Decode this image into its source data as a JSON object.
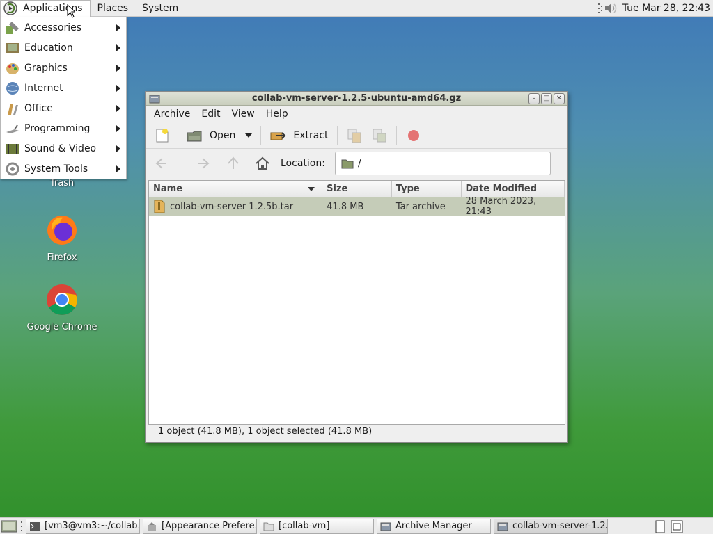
{
  "top_panel": {
    "menus": [
      "Applications",
      "Places",
      "System"
    ],
    "clock": "Tue Mar 28, 22:43"
  },
  "app_menu": {
    "items": [
      {
        "label": "Accessories",
        "icon": "accessories-icon"
      },
      {
        "label": "Education",
        "icon": "education-icon"
      },
      {
        "label": "Graphics",
        "icon": "graphics-icon"
      },
      {
        "label": "Internet",
        "icon": "internet-icon"
      },
      {
        "label": "Office",
        "icon": "office-icon"
      },
      {
        "label": "Programming",
        "icon": "programming-icon"
      },
      {
        "label": "Sound & Video",
        "icon": "sound-video-icon"
      },
      {
        "label": "System Tools",
        "icon": "system-tools-icon"
      }
    ]
  },
  "desktop": {
    "icons": [
      {
        "label": "Trash",
        "icon": "trash-icon"
      },
      {
        "label": "Firefox",
        "icon": "firefox-icon"
      },
      {
        "label": "Google Chrome",
        "icon": "chrome-icon"
      }
    ]
  },
  "window": {
    "title": "collab-vm-server-1.2.5-ubuntu-amd64.gz",
    "menubar": [
      "Archive",
      "Edit",
      "View",
      "Help"
    ],
    "toolbar": {
      "open_label": "Open",
      "extract_label": "Extract"
    },
    "location": {
      "label": "Location:",
      "value": "/"
    },
    "columns": [
      "Name",
      "Size",
      "Type",
      "Date Modified"
    ],
    "rows": [
      {
        "name": "collab-vm-server 1.2.5b.tar",
        "size": "41.8 MB",
        "type": "Tar archive",
        "modified": "28 March 2023, 21:43"
      }
    ],
    "status": "1 object (41.8 MB), 1 object selected (41.8 MB)"
  },
  "taskbar": {
    "tasks": [
      {
        "label": "[vm3@vm3:~/collab...",
        "icon": "terminal-icon"
      },
      {
        "label": "[Appearance Prefere...",
        "icon": "appearance-icon"
      },
      {
        "label": "[collab-vm]",
        "icon": "folder-icon"
      },
      {
        "label": "Archive Manager",
        "icon": "archive-manager-icon"
      },
      {
        "label": "collab-vm-server-1.2....",
        "icon": "archive-manager-icon"
      }
    ]
  },
  "colors": {
    "selection_row": "#c5ccb8",
    "titlebar": "#c9cebd",
    "desktop_top": "#3f79b8",
    "desktop_bottom": "#2f8f2a"
  }
}
